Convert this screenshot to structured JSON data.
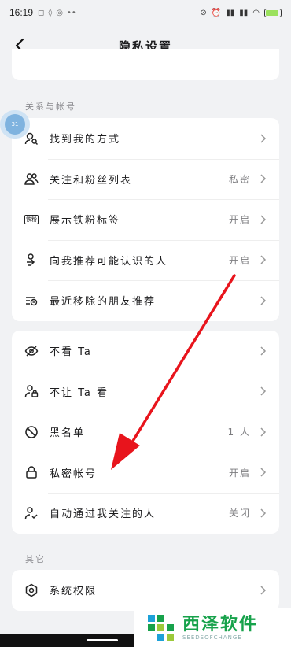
{
  "status_bar": {
    "time": "16:19",
    "icons_right": [
      "mute-icon",
      "alarm-icon",
      "hd-signal-icon",
      "hd-signal-icon",
      "wifi-icon",
      "battery-icon"
    ]
  },
  "header": {
    "title": "隐私设置"
  },
  "sections": {
    "relations_label": "关系与帐号",
    "other_label": "其它"
  },
  "relations": [
    {
      "label": "找到我的方式",
      "value": "",
      "icon": "search-user-icon"
    },
    {
      "label": "关注和粉丝列表",
      "value": "私密",
      "icon": "followers-icon"
    },
    {
      "label": "展示铁粉标签",
      "value": "开启",
      "icon": "fan-badge-icon",
      "badge_text": "铁粉"
    },
    {
      "label": "向我推荐可能认识的人",
      "value": "开启",
      "icon": "recommend-user-icon"
    },
    {
      "label": "最近移除的朋友推荐",
      "value": "",
      "icon": "removed-list-icon"
    }
  ],
  "privacy": [
    {
      "label": "不看 Ta",
      "value": "",
      "icon": "hide-eye-icon"
    },
    {
      "label": "不让 Ta 看",
      "value": "",
      "icon": "lock-user-icon"
    },
    {
      "label": "黑名单",
      "value": "1 人",
      "icon": "block-icon"
    },
    {
      "label": "私密帐号",
      "value": "开启",
      "icon": "lock-icon"
    },
    {
      "label": "自动通过我关注的人",
      "value": "关闭",
      "icon": "auto-approve-icon"
    }
  ],
  "other": [
    {
      "label": "系统权限",
      "value": "",
      "icon": "system-permission-icon"
    }
  ],
  "float_badge": {
    "text": "31"
  },
  "watermark": {
    "brand": "西泽软件",
    "sub": "SEEDSOFCHANGE"
  },
  "colors": {
    "arrow": "#e8141c",
    "accent": "#17a24b"
  }
}
